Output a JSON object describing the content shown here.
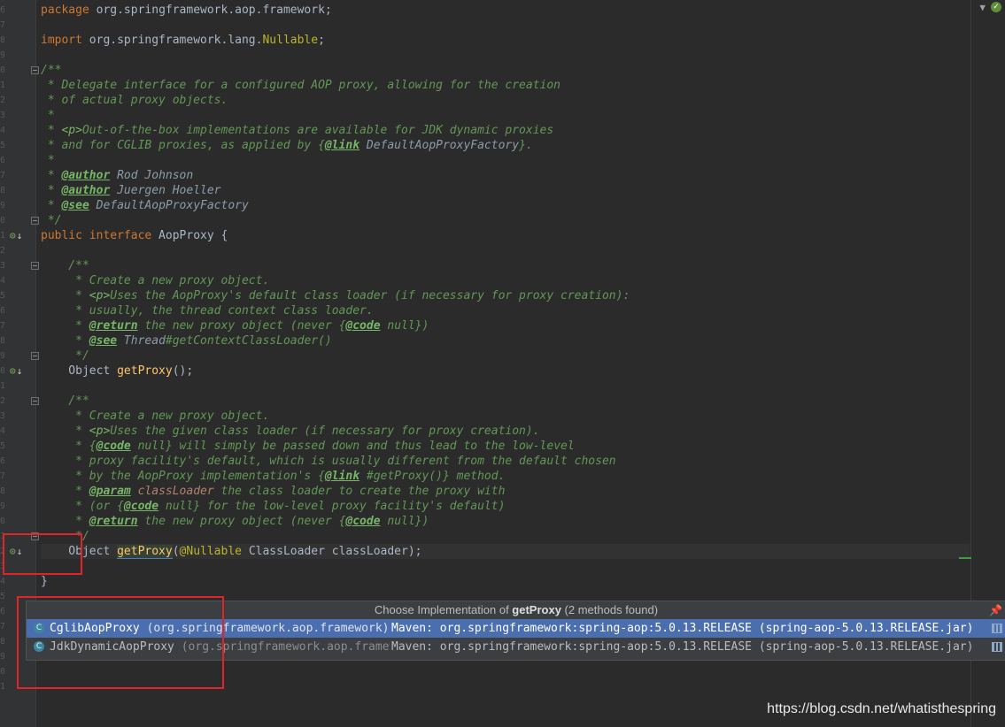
{
  "editor": {
    "gutter_numbers": [
      "6",
      "7",
      "8",
      "9",
      "0",
      "1",
      "2",
      "3",
      "4",
      "5",
      "6",
      "7",
      "8",
      "9",
      "0",
      "1",
      "2",
      "3",
      "4",
      "5",
      "6",
      "7",
      "8",
      "9",
      "0",
      "1",
      "2",
      "3",
      "4",
      "5",
      "6",
      "7",
      "8",
      "9",
      "0",
      "1",
      "2",
      "3",
      "4",
      "5",
      "6",
      "7",
      "8",
      "9",
      "0",
      "1"
    ],
    "code": {
      "package_kw": "package",
      "package_name": " org.springframework.aop.framework;",
      "import_kw": "import",
      "import_name": " org.springframework.lang.",
      "import_class": "Nullable",
      "import_end": ";",
      "doc_open": "/**",
      "doc1": " * Delegate interface for a configured AOP proxy, allowing for the creation",
      "doc2": " * of actual proxy objects.",
      "doc3": " *",
      "doc4_star": " * ",
      "doc4_p": "<p>",
      "doc4_text": "Out-of-the-box implementations are available for JDK dynamic proxies",
      "doc5_text": " * and for CGLIB proxies, as applied by {",
      "doc5_link": "@link",
      "doc5_ref": " DefaultAopProxyFactory",
      "doc5_end": "}.",
      "doc6": " *",
      "doc7_star": " * ",
      "doc7_tag": "@author",
      "doc7_ref": " Rod Johnson",
      "doc8_star": " * ",
      "doc8_tag": "@author",
      "doc8_ref": " Juergen Hoeller",
      "doc9_star": " * ",
      "doc9_tag": "@see",
      "doc9_ref": " DefaultAopProxyFactory",
      "doc_close": " */",
      "iface_kw": "public interface",
      "iface_name": " AopProxy {",
      "m1_open": "    /**",
      "m1_d1": "     * Create a new proxy object.",
      "m1_d2_star": "     * ",
      "m1_d2_p": "<p>",
      "m1_d2_text": "Uses the AopProxy's default class loader (if necessary for proxy creation):",
      "m1_d3": "     * usually, the thread context class loader.",
      "m1_d4_star": "     * ",
      "m1_d4_tag": "@return",
      "m1_d4_text": " the new proxy object (never {",
      "m1_d4_code": "@code",
      "m1_d4_end": " null})",
      "m1_d5_star": "     * ",
      "m1_d5_tag": "@see",
      "m1_d5_ref": " Thread",
      "m1_d5_end": "#getContextClassLoader()",
      "m1_close": "     */",
      "m1_sig_type": "    Object ",
      "m1_sig_fn": "getProxy",
      "m1_sig_end": "();",
      "m2_open": "    /**",
      "m2_d1": "     * Create a new proxy object.",
      "m2_d2_star": "     * ",
      "m2_d2_p": "<p>",
      "m2_d2_text": "Uses the given class loader (if necessary for proxy creation).",
      "m2_d3_a": "     * {",
      "m2_d3_code": "@code",
      "m2_d3_b": " null} will simply be passed down and thus lead to the low-level",
      "m2_d4": "     * proxy facility's default, which is usually different from the default chosen",
      "m2_d5_a": "     * by the AopProxy implementation's {",
      "m2_d5_link": "@link",
      "m2_d5_b": " #getProxy()} method.",
      "m2_d6_star": "     * ",
      "m2_d6_tag": "@param",
      "m2_d6_param": " classLoader",
      "m2_d6_text": " the class loader to create the proxy with",
      "m2_d7_a": "     * (or {",
      "m2_d7_code": "@code",
      "m2_d7_b": " null} for the low-level proxy facility's default)",
      "m2_d8_star": "     * ",
      "m2_d8_tag": "@return",
      "m2_d8_text": " the new proxy object (never {",
      "m2_d8_code": "@code",
      "m2_d8_end": " null})",
      "m2_close": "     */",
      "m2_sig_type": "    Object ",
      "m2_sig_fn": "getProxy",
      "m2_sig_paren": "(",
      "m2_sig_ann": "@Nullable",
      "m2_sig_rest": " ClassLoader classLoader);",
      "closing_brace": "}"
    }
  },
  "popup": {
    "title_prefix": "Choose Implementation of ",
    "title_method": "getProxy",
    "title_suffix": " (2 methods found)",
    "items": [
      {
        "icon": "C",
        "name": "CglibAopProxy",
        "package": " (org.springframework.aop.framework)",
        "location": "Maven: org.springframework:spring-aop:5.0.13.RELEASE (spring-aop-5.0.13.RELEASE.jar)",
        "selected": true
      },
      {
        "icon": "C",
        "name": "JdkDynamicAopProxy",
        "package": " (org.springframework.aop.framework)",
        "location": "Maven: org.springframework:spring-aop:5.0.13.RELEASE (spring-aop-5.0.13.RELEASE.jar)",
        "selected": false
      }
    ]
  },
  "watermark": "https://blog.csdn.net/whatisthespring",
  "colors": {
    "editor_bg": "#2b2b2b",
    "keyword": "#cc7832",
    "javadoc": "#629755",
    "method": "#ffc66d",
    "annotation": "#bbb529",
    "selection": "#4b6eaf",
    "highlight_box": "#e0242a"
  }
}
